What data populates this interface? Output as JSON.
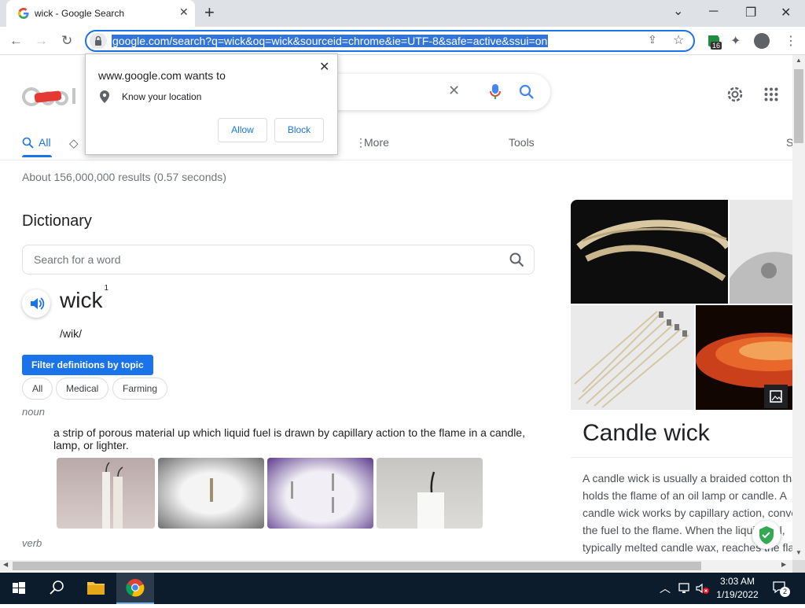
{
  "browser": {
    "tab_title": "wick - Google Search",
    "new_tab": "+",
    "url": "google.com/search?q=wick&oq=wick&sourceid=chrome&ie=UTF-8&safe=active&ssui=on",
    "extension_badge": "16"
  },
  "permission_popup": {
    "header": "www.google.com wants to",
    "permission": "Know your location",
    "allow_label": "Allow",
    "block_label": "Block",
    "close_label": "✕"
  },
  "search": {
    "tabs": [
      {
        "label": "All"
      },
      {
        "label": "More"
      },
      {
        "label": "Tools"
      },
      {
        "label": "S"
      }
    ],
    "results_count": "About 156,000,000 results (0.57 seconds)"
  },
  "dictionary": {
    "title": "Dictionary",
    "search_placeholder": "Search for a word",
    "word": "wick",
    "superscript": "1",
    "pronunciation": "/wik/",
    "filter_button": "Filter definitions by topic",
    "chips": [
      "All",
      "Medical",
      "Farming"
    ],
    "pos_noun": "noun",
    "definition": "a strip of porous material up which liquid fuel is drawn by capillary action to the flame in a candle, lamp, or lighter.",
    "pos_verb": "verb"
  },
  "knowledge_panel": {
    "title": "Candle wick",
    "description": "A candle wick is usually a braided cotton that holds the flame of an oil lamp or candle. A candle wick works by capillary action, conveying the fuel to the flame. When the liquid fuel, typically melted candle wax, reaches the flame it then vaporizes and..."
  },
  "taskbar": {
    "time": "3:03 AM",
    "date": "1/19/2022",
    "notification_count": "2"
  },
  "colors": {
    "accent": "#1a73e8",
    "url_highlight": "#3374d8",
    "taskbar": "#0c1c2c"
  }
}
